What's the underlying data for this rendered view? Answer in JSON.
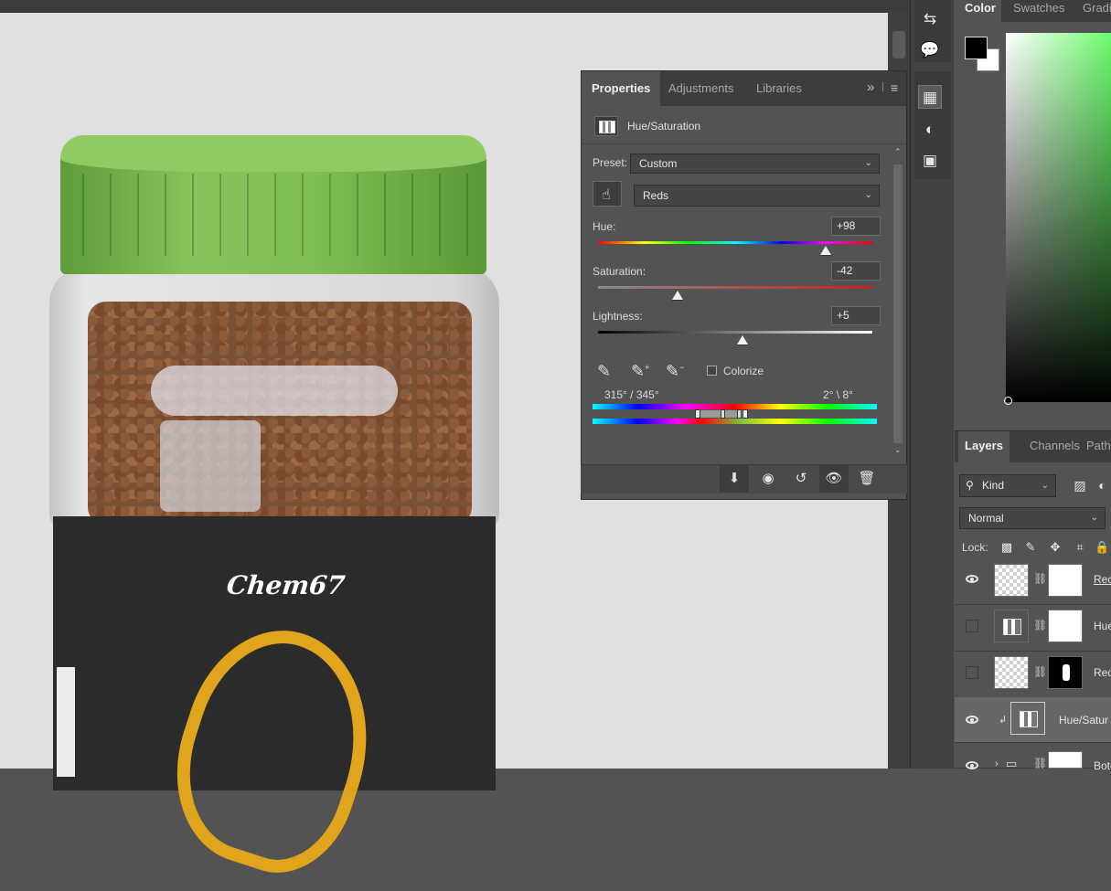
{
  "properties_panel": {
    "tabs": [
      "Properties",
      "Adjustments",
      "Libraries"
    ],
    "title": "Hue/Saturation",
    "preset_label": "Preset:",
    "preset_value": "Custom",
    "channel_value": "Reds",
    "hue": {
      "label": "Hue:",
      "value": "+98",
      "level": 0.83
    },
    "saturation": {
      "label": "Saturation:",
      "value": "-42",
      "level": 0.29
    },
    "lightness": {
      "label": "Lightness:",
      "value": "+5",
      "level": 0.525
    },
    "colorize_label": "Colorize",
    "range_left": "315° / 345°",
    "range_right": "2° \\ 8°",
    "overflow_icon": "»",
    "menu_icon": "≡"
  },
  "color_panel": {
    "tabs": [
      "Color",
      "Swatches",
      "Gradi"
    ],
    "foreground": "#000000",
    "background": "#ffffff"
  },
  "layers_panel": {
    "tabs": [
      "Layers",
      "Channels",
      "Path"
    ],
    "filter_label": "Kind",
    "blend_mode": "Normal",
    "lock_label": "Lock:",
    "layers": [
      {
        "name": "Rec",
        "visible": true
      },
      {
        "name": "Hue",
        "visible": false
      },
      {
        "name": "Rec",
        "visible": false
      },
      {
        "name": "Hue/Satur",
        "visible": true
      },
      {
        "name": "Bote",
        "visible": true
      }
    ]
  },
  "canvas": {
    "brand_text": "Chem67"
  },
  "colors": {
    "accent_panel": "#535353",
    "cap_green": "#7fbe53",
    "label_dark": "#2b2b2b",
    "swirl_gold": "#e0a51c"
  }
}
